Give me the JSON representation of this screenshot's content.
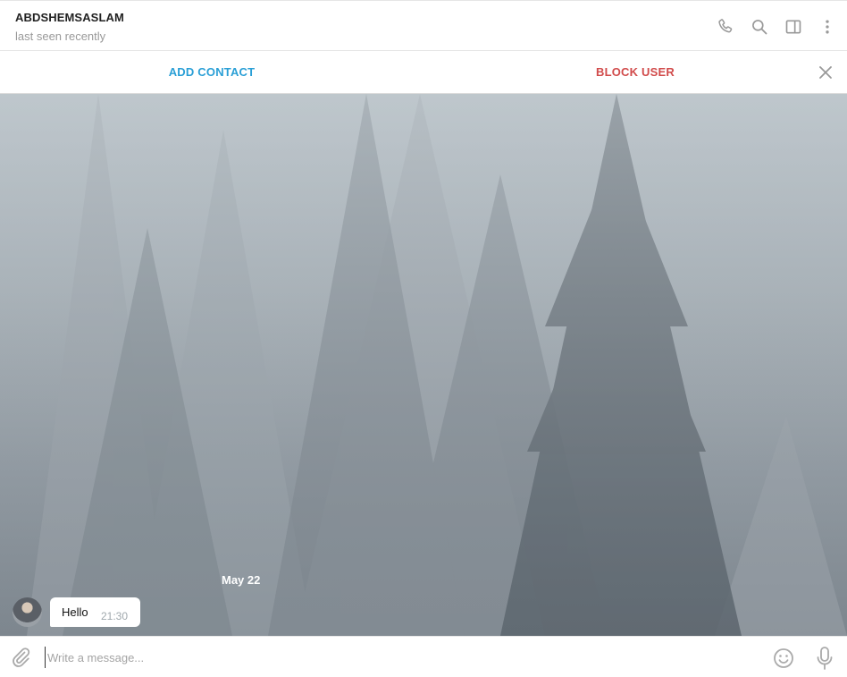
{
  "header": {
    "peer_name": "ABDSHEMSASLAM",
    "peer_status": "last seen recently",
    "icons": [
      "phone-icon",
      "search-icon",
      "sidebar-toggle-icon",
      "more-vertical-icon"
    ]
  },
  "action_bar": {
    "add_contact_label": "ADD CONTACT",
    "block_user_label": "BLOCK USER",
    "close_icon": "close-icon"
  },
  "chat": {
    "background": "misty pine forest wallpaper",
    "date_separator": "May 22",
    "messages": [
      {
        "text": "Hello",
        "time": "21:30",
        "incoming": true
      }
    ]
  },
  "composer": {
    "placeholder": "Write a message...",
    "attach_icon": "paperclip-icon",
    "emoji_icon": "emoji-icon",
    "mic_icon": "microphone-icon"
  },
  "colors": {
    "accent_blue": "#2a9fd6",
    "danger_red": "#d14b4b",
    "icon_gray": "#999999"
  }
}
